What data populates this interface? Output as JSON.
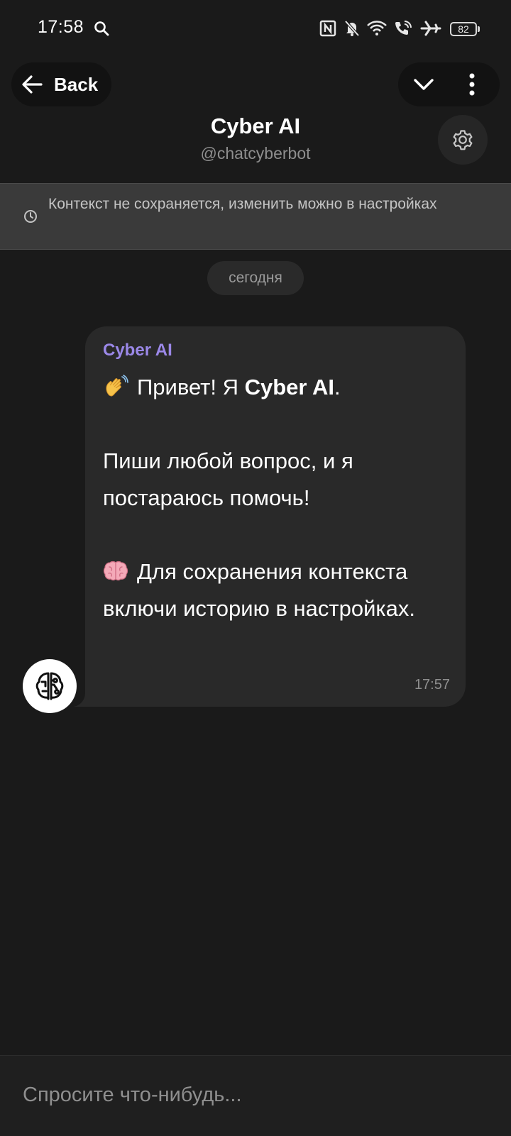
{
  "status_bar": {
    "time": "17:58",
    "battery": "82",
    "icons": [
      "search-icon",
      "nfc-icon",
      "bell-off-icon",
      "wifi-icon",
      "wifi-call-icon",
      "airplane-icon",
      "battery-icon"
    ]
  },
  "header": {
    "back_label": "Back",
    "title": "Cyber AI",
    "subtitle": "@chatcyberbot",
    "icons": [
      "back-arrow-icon",
      "chevron-down-icon",
      "more-vertical-icon",
      "gear-icon"
    ]
  },
  "banner": {
    "text": "Контекст не сохраняется, изменить можно в настройках",
    "icon": "clock-icon"
  },
  "date_separator": "сегодня",
  "message": {
    "sender": "Cyber AI",
    "greeting_pre": "Привет! Я ",
    "greeting_bold": "Cyber AI",
    "greeting_post": ".",
    "line2": "Пиши любой вопрос, и я постараюсь помочь!",
    "line3": "Для сохранения контекста включи историю в настройках.",
    "time": "17:57",
    "emojis": [
      "waving-hand-emoji",
      "brain-emoji"
    ],
    "sender_color": "#9b88e8"
  },
  "input": {
    "placeholder": "Спросите что-нибудь..."
  },
  "colors": {
    "background": "#1a1a1a",
    "bubble": "#292929",
    "banner": "#3a3a3a"
  }
}
